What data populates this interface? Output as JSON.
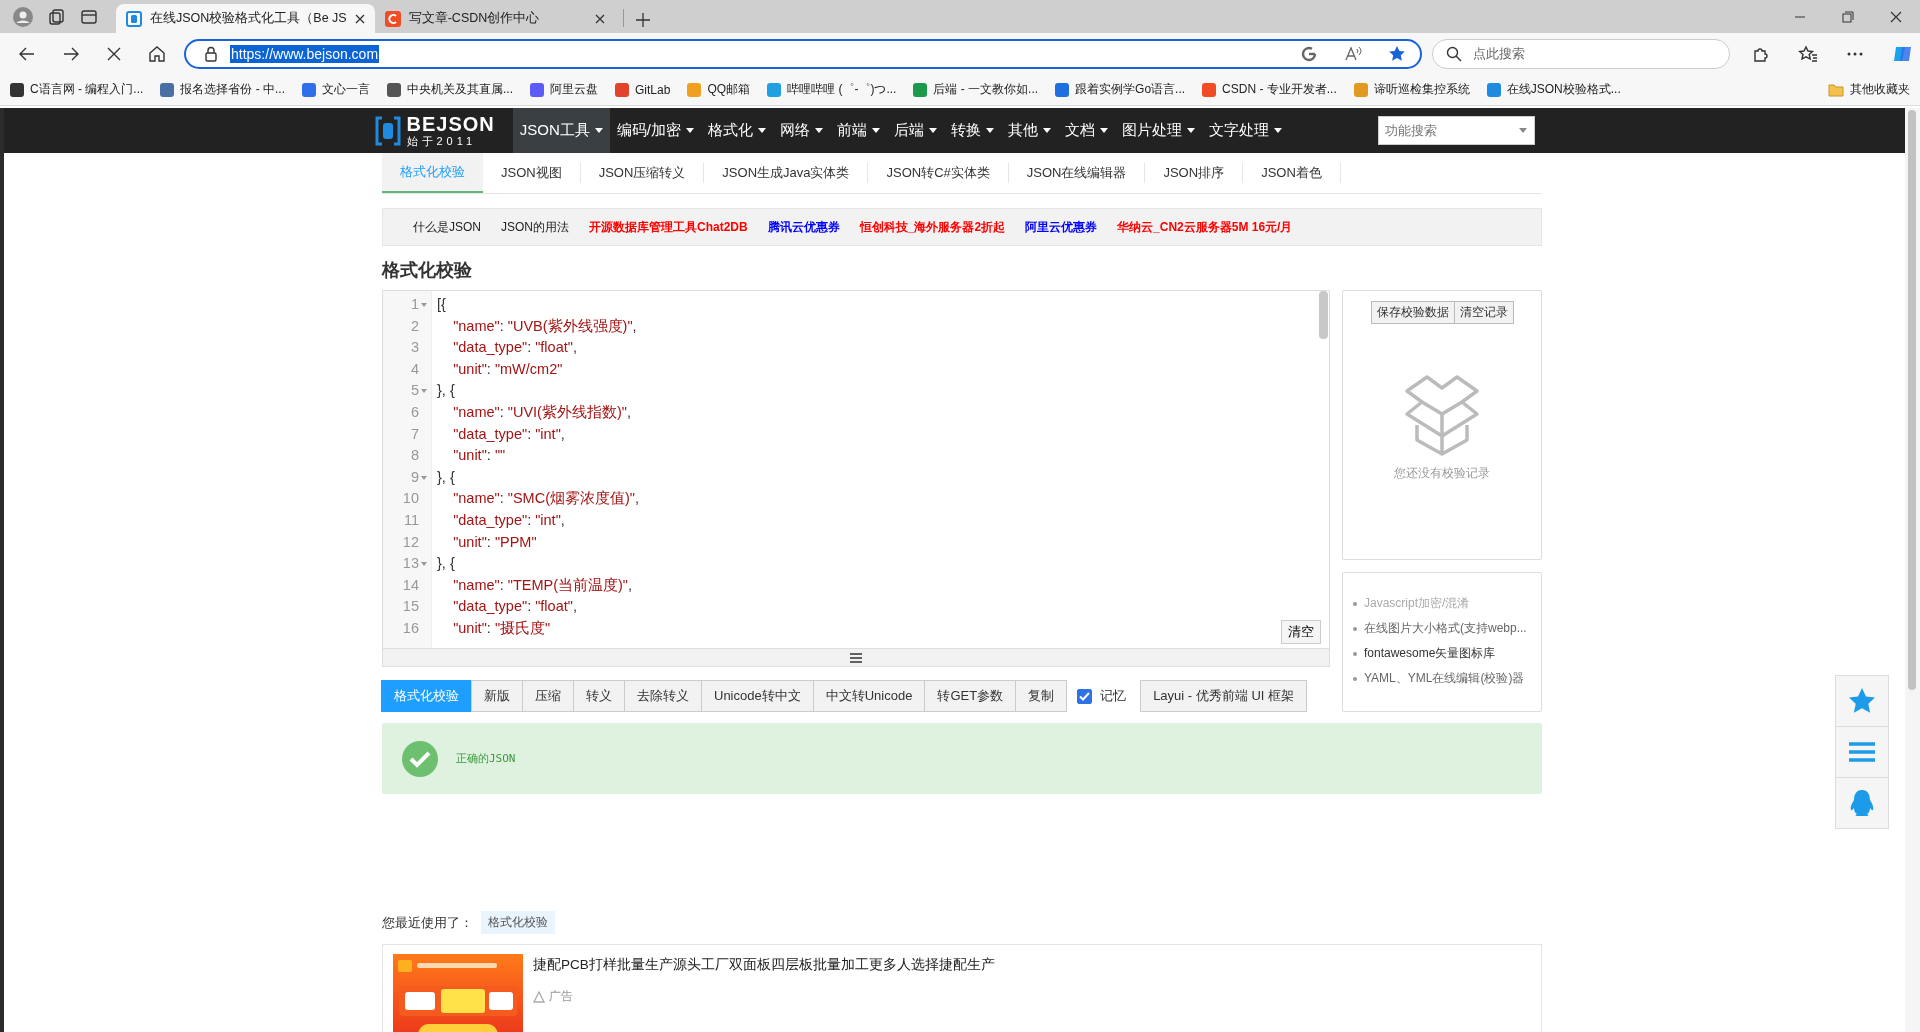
{
  "browser": {
    "tabs": [
      {
        "title": "在线JSON校验格式化工具（Be JS",
        "selected": true
      },
      {
        "title": "写文章-CSDN创作中心",
        "selected": false
      }
    ],
    "address": {
      "url": "https://www.bejson.com",
      "highlighted": true
    },
    "search": {
      "placeholder": "点此搜索"
    },
    "bookmarks": [
      {
        "label": "C语言网 - 编程入门...",
        "color": "#333333"
      },
      {
        "label": "报名选择省份 - 中...",
        "color": "#4a6fa5"
      },
      {
        "label": "文心一言",
        "color": "#2f6fea"
      },
      {
        "label": "中央机关及其直属...",
        "color": "#555555"
      },
      {
        "label": "阿里云盘",
        "color": "#5b5bf5"
      },
      {
        "label": "GitLab",
        "color": "#e2432a"
      },
      {
        "label": "QQ邮箱",
        "color": "#f0a020"
      },
      {
        "label": "哔哩哔哩 (゜-゜)つ...",
        "color": "#20a0e0"
      },
      {
        "label": "后端 - 一文教你如...",
        "color": "#1a9a4a"
      },
      {
        "label": "跟着实例学Go语言...",
        "color": "#1f6fe0"
      },
      {
        "label": "CSDN - 专业开发者...",
        "color": "#f24c27"
      },
      {
        "label": "谛听巡检集控系统",
        "color": "#e09a20"
      },
      {
        "label": "在线JSON校验格式...",
        "color": "#1e8be0"
      }
    ],
    "other_bookmarks": "其他收藏夹"
  },
  "site": {
    "logo": {
      "title": "BEJSON",
      "subtitle": "始于2011"
    },
    "menu": [
      {
        "label": "JSON工具",
        "selected": true
      },
      {
        "label": "编码/加密",
        "selected": false
      },
      {
        "label": "格式化",
        "selected": false
      },
      {
        "label": "网络",
        "selected": false
      },
      {
        "label": "前端",
        "selected": false
      },
      {
        "label": "后端",
        "selected": false
      },
      {
        "label": "转换",
        "selected": false
      },
      {
        "label": "其他",
        "selected": false
      },
      {
        "label": "文档",
        "selected": false
      },
      {
        "label": "图片处理",
        "selected": false
      },
      {
        "label": "文字处理",
        "selected": false
      }
    ],
    "search": {
      "placeholder": "功能搜索"
    },
    "subtabs": [
      {
        "label": "格式化校验",
        "selected": true
      },
      {
        "label": "JSON视图",
        "selected": false
      },
      {
        "label": "JSON压缩转义",
        "selected": false
      },
      {
        "label": "JSON生成Java实体类",
        "selected": false
      },
      {
        "label": "JSON转C#实体类",
        "selected": false
      },
      {
        "label": "JSON在线编辑器",
        "selected": false
      },
      {
        "label": "JSON排序",
        "selected": false
      },
      {
        "label": "JSON着色",
        "selected": false
      }
    ],
    "links": [
      {
        "label": "什么是JSON",
        "color": "#222222"
      },
      {
        "label": "JSON的用法",
        "color": "#222222"
      },
      {
        "label": "开源数据库管理工具Chat2DB",
        "color": "#ff0000"
      },
      {
        "label": "腾讯云优惠券",
        "color": "#0000ff"
      },
      {
        "label": "恒创科技_海外服务器2折起",
        "color": "#ff0000"
      },
      {
        "label": "阿里云优惠券",
        "color": "#0000ff"
      },
      {
        "label": "华纳云_CN2云服务器5M 16元/月",
        "color": "#ff0000"
      }
    ]
  },
  "tool": {
    "title": "格式化校验",
    "editor": {
      "lines": [
        {
          "number": "1",
          "foldable": true,
          "code": "[{"
        },
        {
          "number": "2",
          "foldable": false,
          "code": "    \"name\": \"UVB(紫外线强度)\","
        },
        {
          "number": "3",
          "foldable": false,
          "code": "    \"data_type\": \"float\","
        },
        {
          "number": "4",
          "foldable": false,
          "code": "    \"unit\": \"mW/cm2\""
        },
        {
          "number": "5",
          "foldable": true,
          "code": "}, {"
        },
        {
          "number": "6",
          "foldable": false,
          "code": "    \"name\": \"UVI(紫外线指数)\","
        },
        {
          "number": "7",
          "foldable": false,
          "code": "    \"data_type\": \"int\","
        },
        {
          "number": "8",
          "foldable": false,
          "code": "    \"unit\": \"\""
        },
        {
          "number": "9",
          "foldable": true,
          "code": "}, {"
        },
        {
          "number": "10",
          "foldable": false,
          "code": "    \"name\": \"SMC(烟雾浓度值)\","
        },
        {
          "number": "11",
          "foldable": false,
          "code": "    \"data_type\": \"int\","
        },
        {
          "number": "12",
          "foldable": false,
          "code": "    \"unit\": \"PPM\""
        },
        {
          "number": "13",
          "foldable": true,
          "code": "}, {"
        },
        {
          "number": "14",
          "foldable": false,
          "code": "    \"name\": \"TEMP(当前温度)\","
        },
        {
          "number": "15",
          "foldable": false,
          "code": "    \"data_type\": \"float\","
        },
        {
          "number": "16",
          "foldable": false,
          "code": "    \"unit\": \"摄氏度\""
        }
      ],
      "clear_button": "清空"
    },
    "history": {
      "buttons": [
        "保存校验数据",
        "清空记录"
      ],
      "empty_text": "您还没有校验记录"
    },
    "related": [
      "Javascript加密/混淆",
      "在线图片大小格式(支持webp...",
      "fontawesome矢量图标库",
      "YAML、YML在线编辑(校验)器"
    ],
    "buttons": [
      {
        "label": "格式化校验",
        "selected": true
      },
      {
        "label": "新版",
        "selected": false
      },
      {
        "label": "压缩",
        "selected": false
      },
      {
        "label": "转义",
        "selected": false
      },
      {
        "label": "去除转义",
        "selected": false
      },
      {
        "label": "Unicode转中文",
        "selected": false
      },
      {
        "label": "中文转Unicode",
        "selected": false
      },
      {
        "label": "转GET参数",
        "selected": false
      },
      {
        "label": "复制",
        "selected": false
      }
    ],
    "remember": {
      "label": "记忆",
      "checked": true
    },
    "layui_button": "Layui - 优秀前端 UI 框架",
    "result": {
      "kind": "success",
      "message": "正确的JSON"
    }
  },
  "recent": {
    "label": "您最近使用了：",
    "tags": [
      "格式化校验"
    ]
  },
  "ad": {
    "kind": "picture",
    "title": "捷配PCB打样批量生产源头工厂双面板四层板批量加工更多人选择捷配生产",
    "tag": "广告"
  }
}
